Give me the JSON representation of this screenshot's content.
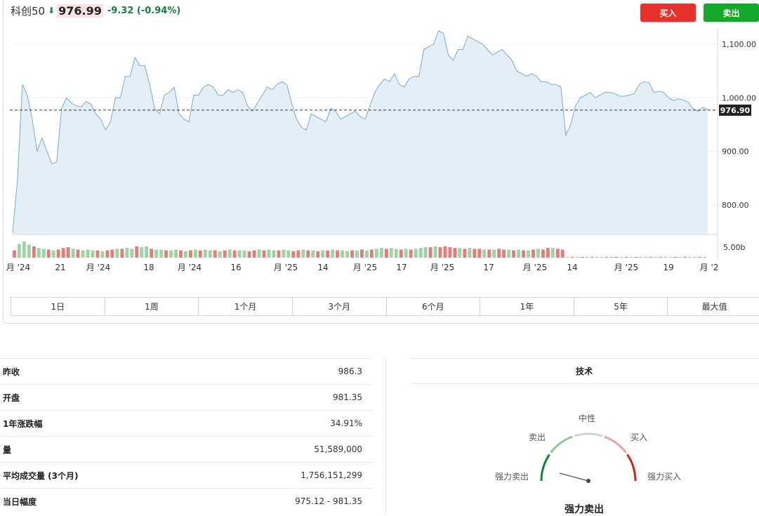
{
  "header": {
    "name": "科创50",
    "price": "976.99",
    "change": "-9.32 (-0.94%)"
  },
  "actions": {
    "buy_label": "买入",
    "sell_label": "卖出"
  },
  "colors": {
    "up": "#d95b5b",
    "down": "#13803d",
    "line": "#7aabd1",
    "area": "#e4eef7",
    "buy": "#e6312c",
    "sell": "#16a82a"
  },
  "chart_data": {
    "type": "area",
    "ylim": [
      745,
      1130
    ],
    "y_ticks": [
      {
        "value": 1100,
        "label": "1,100.00"
      },
      {
        "value": 1000,
        "label": "1,000.00"
      },
      {
        "value": 900,
        "label": "900.00"
      },
      {
        "value": 800,
        "label": "800.00"
      }
    ],
    "current": {
      "value": 976.9,
      "label": "976.90"
    },
    "volume_label": "5.00b",
    "x_ticks": [
      "月 '24",
      "21",
      "月 '24",
      "18",
      "月 '24",
      "16",
      "月 '25",
      "14",
      "月 '25",
      "17",
      "月 '25",
      "17",
      "月 '25",
      "14",
      "月 '25",
      "19",
      "月 '2"
    ],
    "values": [
      748,
      850,
      1025,
      1005,
      960,
      900,
      925,
      900,
      877,
      880,
      980,
      1000,
      990,
      985,
      983,
      993,
      988,
      970,
      960,
      940,
      955,
      1000,
      1000,
      1040,
      1040,
      1075,
      1060,
      1060,
      1025,
      980,
      970,
      1005,
      1010,
      1020,
      970,
      960,
      955,
      1005,
      1005,
      1020,
      1025,
      1020,
      1005,
      1005,
      1015,
      1010,
      1015,
      1010,
      985,
      975,
      990,
      1005,
      1020,
      1015,
      1025,
      1030,
      1025,
      990,
      960,
      945,
      940,
      970,
      965,
      960,
      955,
      980,
      975,
      960,
      965,
      970,
      975,
      965,
      960,
      985,
      1010,
      1025,
      1035,
      1030,
      1045,
      1025,
      1020,
      1035,
      1040,
      1040,
      1090,
      1095,
      1100,
      1125,
      1120,
      1080,
      1070,
      1090,
      1090,
      1115,
      1110,
      1105,
      1100,
      1090,
      1080,
      1085,
      1090,
      1080,
      1070,
      1050,
      1045,
      1040,
      1045,
      1040,
      1030,
      1030,
      1025,
      1025,
      1020,
      930,
      950,
      985,
      1000,
      1005,
      1010,
      1000,
      1005,
      1010,
      1010,
      1008,
      1003,
      1003,
      1005,
      1008,
      1025,
      1030,
      1028,
      1010,
      1012,
      1010,
      1000,
      995,
      998,
      996,
      992,
      980,
      975,
      982,
      978
    ],
    "volume": [
      {
        "v": 0.45,
        "up": false
      },
      {
        "v": 0.85,
        "up": true
      },
      {
        "v": 1.0,
        "up": true
      },
      {
        "v": 0.8,
        "up": true
      },
      {
        "v": 0.7,
        "up": false
      },
      {
        "v": 0.6,
        "up": true
      },
      {
        "v": 0.55,
        "up": true
      },
      {
        "v": 0.5,
        "up": false
      },
      {
        "v": 0.45,
        "up": true
      },
      {
        "v": 0.5,
        "up": false
      },
      {
        "v": 0.6,
        "up": false
      },
      {
        "v": 0.65,
        "up": false
      },
      {
        "v": 0.55,
        "up": true
      },
      {
        "v": 0.5,
        "up": false
      },
      {
        "v": 0.45,
        "up": true
      },
      {
        "v": 0.5,
        "up": true
      },
      {
        "v": 0.45,
        "up": true
      },
      {
        "v": 0.45,
        "up": false
      },
      {
        "v": 0.4,
        "up": true
      },
      {
        "v": 0.45,
        "up": false
      },
      {
        "v": 0.5,
        "up": false
      },
      {
        "v": 0.55,
        "up": true
      },
      {
        "v": 0.55,
        "up": false
      },
      {
        "v": 0.6,
        "up": true
      },
      {
        "v": 0.55,
        "up": true
      },
      {
        "v": 0.7,
        "up": false
      },
      {
        "v": 0.65,
        "up": true
      },
      {
        "v": 0.7,
        "up": true
      },
      {
        "v": 0.55,
        "up": false
      },
      {
        "v": 0.5,
        "up": true
      },
      {
        "v": 0.5,
        "up": true
      },
      {
        "v": 0.45,
        "up": false
      },
      {
        "v": 0.45,
        "up": true
      },
      {
        "v": 0.5,
        "up": true
      },
      {
        "v": 0.45,
        "up": false
      },
      {
        "v": 0.4,
        "up": true
      },
      {
        "v": 0.45,
        "up": false
      },
      {
        "v": 0.5,
        "up": true
      },
      {
        "v": 0.45,
        "up": false
      },
      {
        "v": 0.5,
        "up": true
      },
      {
        "v": 0.45,
        "up": true
      },
      {
        "v": 0.45,
        "up": false
      },
      {
        "v": 0.4,
        "up": true
      },
      {
        "v": 0.45,
        "up": false
      },
      {
        "v": 0.5,
        "up": true
      },
      {
        "v": 0.45,
        "up": false
      },
      {
        "v": 0.45,
        "up": true
      },
      {
        "v": 0.45,
        "up": true
      },
      {
        "v": 0.4,
        "up": false
      },
      {
        "v": 0.45,
        "up": false
      },
      {
        "v": 0.5,
        "up": true
      },
      {
        "v": 0.45,
        "up": false
      },
      {
        "v": 0.5,
        "up": true
      },
      {
        "v": 0.45,
        "up": true
      },
      {
        "v": 0.45,
        "up": false
      },
      {
        "v": 0.5,
        "up": true
      },
      {
        "v": 0.45,
        "up": true
      },
      {
        "v": 0.4,
        "up": false
      },
      {
        "v": 0.45,
        "up": false
      },
      {
        "v": 0.5,
        "up": true
      },
      {
        "v": 0.45,
        "up": false
      },
      {
        "v": 0.45,
        "up": true
      },
      {
        "v": 0.4,
        "up": false
      },
      {
        "v": 0.45,
        "up": true
      },
      {
        "v": 0.45,
        "up": false
      },
      {
        "v": 0.5,
        "up": true
      },
      {
        "v": 0.45,
        "up": false
      },
      {
        "v": 0.45,
        "up": true
      },
      {
        "v": 0.4,
        "up": true
      },
      {
        "v": 0.45,
        "up": false
      },
      {
        "v": 0.45,
        "up": true
      },
      {
        "v": 0.5,
        "up": false
      },
      {
        "v": 0.45,
        "up": true
      },
      {
        "v": 0.5,
        "up": false
      },
      {
        "v": 0.55,
        "up": true
      },
      {
        "v": 0.6,
        "up": true
      },
      {
        "v": 0.55,
        "up": false
      },
      {
        "v": 0.6,
        "up": true
      },
      {
        "v": 0.55,
        "up": true
      },
      {
        "v": 0.5,
        "up": false
      },
      {
        "v": 0.55,
        "up": true
      },
      {
        "v": 0.5,
        "up": false
      },
      {
        "v": 0.55,
        "up": true
      },
      {
        "v": 0.6,
        "up": true
      },
      {
        "v": 0.65,
        "up": true
      },
      {
        "v": 0.65,
        "up": false
      },
      {
        "v": 0.7,
        "up": true
      },
      {
        "v": 0.65,
        "up": false
      },
      {
        "v": 0.7,
        "up": false
      },
      {
        "v": 0.65,
        "up": false
      },
      {
        "v": 0.6,
        "up": false
      },
      {
        "v": 0.6,
        "up": true
      },
      {
        "v": 0.55,
        "up": false
      },
      {
        "v": 0.6,
        "up": true
      },
      {
        "v": 0.55,
        "up": false
      },
      {
        "v": 0.55,
        "up": false
      },
      {
        "v": 0.5,
        "up": true
      },
      {
        "v": 0.5,
        "up": false
      },
      {
        "v": 0.5,
        "up": true
      },
      {
        "v": 0.55,
        "up": false
      },
      {
        "v": 0.5,
        "up": false
      },
      {
        "v": 0.5,
        "up": true
      },
      {
        "v": 0.45,
        "up": false
      },
      {
        "v": 0.5,
        "up": true
      },
      {
        "v": 0.45,
        "up": false
      },
      {
        "v": 0.45,
        "up": true
      },
      {
        "v": 0.5,
        "up": false
      },
      {
        "v": 0.55,
        "up": true
      },
      {
        "v": 0.5,
        "up": false
      },
      {
        "v": 0.6,
        "up": false
      },
      {
        "v": 0.6,
        "up": true
      },
      {
        "v": 0.55,
        "up": false
      },
      {
        "v": 0.5,
        "up": false
      },
      {
        "v": 0.05,
        "up": true
      },
      {
        "v": 0.05,
        "up": false
      },
      {
        "v": 0.05,
        "up": true
      },
      {
        "v": 0.05,
        "up": false
      },
      {
        "v": 0.05,
        "up": true
      },
      {
        "v": 0.05,
        "up": false
      },
      {
        "v": 0.05,
        "up": true
      },
      {
        "v": 0.05,
        "up": true
      },
      {
        "v": 0.05,
        "up": false
      },
      {
        "v": 0.05,
        "up": true
      },
      {
        "v": 0.05,
        "up": false
      },
      {
        "v": 0.05,
        "up": true
      },
      {
        "v": 0.05,
        "up": false
      },
      {
        "v": 0.05,
        "up": true
      },
      {
        "v": 0.05,
        "up": false
      },
      {
        "v": 0.05,
        "up": true
      },
      {
        "v": 0.05,
        "up": true
      },
      {
        "v": 0.05,
        "up": false
      },
      {
        "v": 0.05,
        "up": true
      },
      {
        "v": 0.05,
        "up": false
      },
      {
        "v": 0.05,
        "up": true
      },
      {
        "v": 0.05,
        "up": true
      },
      {
        "v": 0.05,
        "up": false
      },
      {
        "v": 0.05,
        "up": true
      },
      {
        "v": 0.05,
        "up": false
      },
      {
        "v": 0.05,
        "up": true
      },
      {
        "v": 0.05,
        "up": true
      },
      {
        "v": 0.05,
        "up": false
      },
      {
        "v": 0.05,
        "up": true
      }
    ]
  },
  "ranges": [
    "1日",
    "1周",
    "1个月",
    "3个月",
    "6个月",
    "1年",
    "5年",
    "最大值"
  ],
  "stats": [
    {
      "label": "昨收",
      "value": "986.3"
    },
    {
      "label": "开盘",
      "value": "981.35"
    },
    {
      "label": "1年涨跌幅",
      "value": "34.91%"
    },
    {
      "label": "量",
      "value": "51,589,000"
    },
    {
      "label": "平均成交量 (3个月)",
      "value": "1,756,151,299"
    },
    {
      "label": "当日幅度",
      "value": "975.12 - 981.35"
    }
  ],
  "technical": {
    "title": "技术",
    "labels": {
      "neutral": "中性",
      "sell": "卖出",
      "buy": "买入",
      "strong_sell": "强力卖出",
      "strong_buy": "强力买入"
    },
    "result": "强力卖出"
  }
}
